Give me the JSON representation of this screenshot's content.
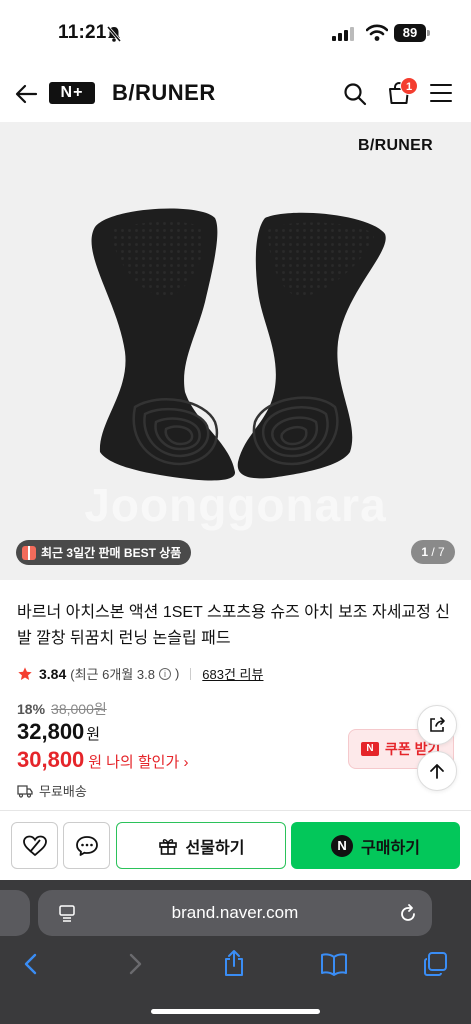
{
  "status_bar": {
    "time": "11:21",
    "battery": "89"
  },
  "header": {
    "nplus": "N+",
    "brand": "B/RUNER",
    "cart_count": "1"
  },
  "product_image": {
    "brand_mark": "B/RUNER",
    "watermark": "Joonggonara",
    "best_badge": "최근 3일간 판매 BEST 상품",
    "page_current": "1",
    "page_total": " / 7"
  },
  "product": {
    "title": "바르너 아치스본 액션 1SET 스포츠용 슈즈 아치 보조 자세교정 신발 깔창 뒤꿈치 런닝 논슬립 패드",
    "rating": "3.84",
    "rating_recent": "(최근 6개월 3.8",
    "rating_recent_close": ")",
    "review_count": "683건 리뷰",
    "discount_pct": "18%",
    "original_price": "38,000원",
    "price": "32,800",
    "price_unit": "원",
    "my_price": "30,800",
    "my_price_unit": "원",
    "my_price_label": "나의 할인가 ›",
    "shipping": "무료배송",
    "coupon_label": "쿠폰 받기"
  },
  "buy_bar": {
    "gift_label": "선물하기",
    "buy_label": "구매하기"
  },
  "safari": {
    "url": "brand.naver.com"
  },
  "colors": {
    "naver_green": "#03c75a",
    "sale_red": "#e5252a",
    "badge_red": "#f43d2f"
  }
}
